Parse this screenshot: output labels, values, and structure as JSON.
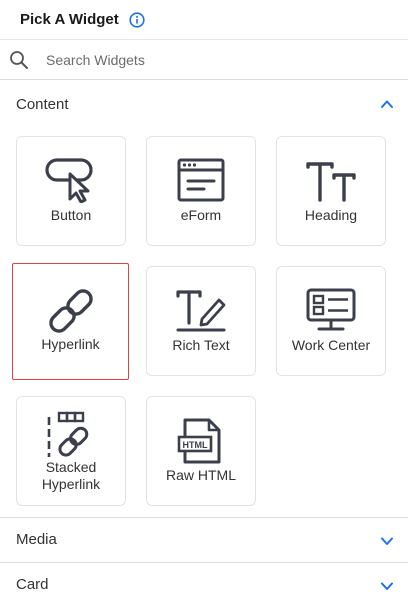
{
  "header": {
    "title": "Pick A Widget",
    "info_icon": "info-circle-icon",
    "accent": "#1a73e8"
  },
  "search": {
    "placeholder": "Search Widgets",
    "icon": "search-icon"
  },
  "sections": {
    "content": {
      "label": "Content",
      "expanded": true
    },
    "media": {
      "label": "Media",
      "expanded": false
    },
    "card": {
      "label": "Card",
      "expanded": false
    }
  },
  "widgets": [
    {
      "label": "Button",
      "icon": "pointer-button-icon"
    },
    {
      "label": "eForm",
      "icon": "eform-icon"
    },
    {
      "label": "Heading",
      "icon": "heading-tt-icon"
    },
    {
      "label": "Hyperlink",
      "icon": "link-icon",
      "selected": true
    },
    {
      "label": "Rich Text",
      "icon": "rich-text-icon"
    },
    {
      "label": "Work Center",
      "icon": "work-center-icon"
    },
    {
      "label": "Stacked Hyperlink",
      "icon": "stacked-hyperlink-icon"
    },
    {
      "label": "Raw HTML",
      "icon": "raw-html-icon"
    }
  ],
  "colors": {
    "selected_border": "#e0413f",
    "chevron": "#1a73e8",
    "icon": "#3a3f4b"
  }
}
